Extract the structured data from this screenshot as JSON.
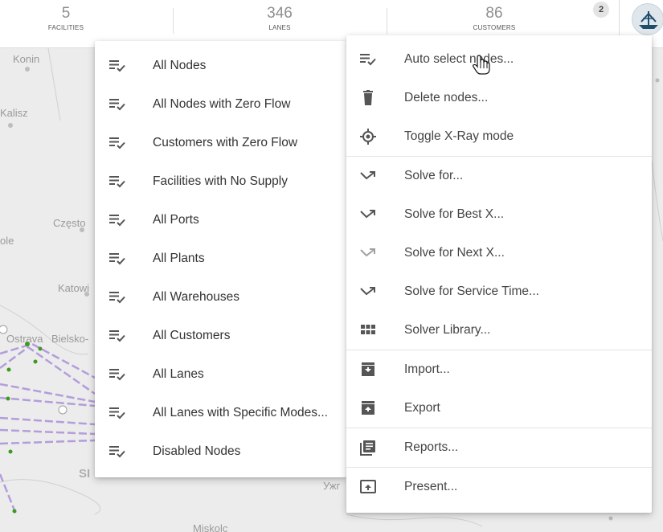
{
  "header": {
    "stats": [
      {
        "value": "5",
        "label": "FACILITIES"
      },
      {
        "value": "346",
        "label": "LANES"
      },
      {
        "value": "86",
        "label": "CUSTOMERS"
      }
    ],
    "badge": "2",
    "logo_icon": "ship-wheel-logo-icon"
  },
  "map": {
    "places": [
      "Konin",
      "Kalisz",
      "Często",
      "Katowi",
      "Ostrava",
      "Bielsko-",
      "ole",
      "Ужг",
      "Miskolc",
      "SI"
    ]
  },
  "left_menu": {
    "items": [
      {
        "label": "All Nodes",
        "icon": "playlist-check-icon"
      },
      {
        "label": "All Nodes with Zero Flow",
        "icon": "playlist-check-icon"
      },
      {
        "label": "Customers with Zero Flow",
        "icon": "playlist-check-icon"
      },
      {
        "label": "Facilities with No Supply",
        "icon": "playlist-check-icon"
      },
      {
        "label": "All Ports",
        "icon": "playlist-check-icon"
      },
      {
        "label": "All Plants",
        "icon": "playlist-check-icon"
      },
      {
        "label": "All Warehouses",
        "icon": "playlist-check-icon"
      },
      {
        "label": "All Customers",
        "icon": "playlist-check-icon"
      },
      {
        "label": "All Lanes",
        "icon": "playlist-check-icon"
      },
      {
        "label": "All Lanes with Specific Modes...",
        "icon": "playlist-check-icon"
      },
      {
        "label": "Disabled Nodes",
        "icon": "playlist-check-icon"
      }
    ]
  },
  "right_menu": {
    "items": [
      {
        "label": "Auto select nodes...",
        "icon": "playlist-check-icon"
      },
      {
        "label": "Delete nodes...",
        "icon": "trash-icon"
      },
      {
        "label": "Toggle X-Ray mode",
        "icon": "crosshair-icon"
      },
      {
        "label": "Solve for...",
        "icon": "trend-arrow-icon"
      },
      {
        "label": "Solve for Best X...",
        "icon": "trend-arrow-icon"
      },
      {
        "label": "Solve for Next X...",
        "icon": "trend-arrow-icon",
        "disabled": true
      },
      {
        "label": "Solve for Service Time...",
        "icon": "trend-arrow-icon"
      },
      {
        "label": "Solver Library...",
        "icon": "grid-icon"
      },
      {
        "label": "Import...",
        "icon": "import-tray-icon"
      },
      {
        "label": "Export",
        "icon": "export-tray-icon"
      },
      {
        "label": "Reports...",
        "icon": "library-books-icon"
      },
      {
        "label": "Present...",
        "icon": "present-to-all-icon"
      }
    ]
  },
  "colors": {
    "lane": "#b39ddb",
    "node": "#3c9a1f",
    "menu_text": "#333333",
    "disabled_text": "#b5b5b5"
  }
}
